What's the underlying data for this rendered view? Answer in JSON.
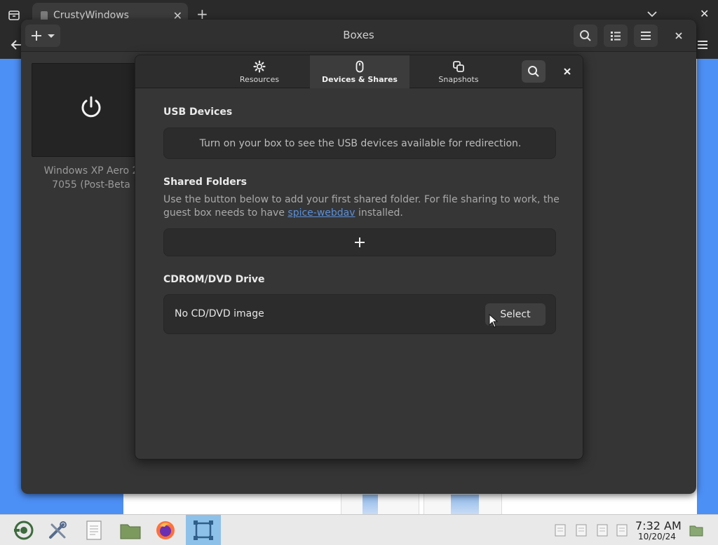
{
  "browser": {
    "tab_title": "CrustyWindows",
    "tab_close": "✕",
    "new_tab": "+",
    "window_close": "✕"
  },
  "boxes": {
    "title": "Boxes",
    "vm": {
      "name": "Windows XP Aero 2 7055 (Post-Beta"
    }
  },
  "dialog": {
    "tabs": [
      {
        "label": "Resources",
        "icon": "gear-icon"
      },
      {
        "label": "Devices & Shares",
        "icon": "mouse-icon"
      },
      {
        "label": "Snapshots",
        "icon": "snapshots-icon"
      }
    ],
    "active_tab": "Devices & Shares",
    "usb": {
      "title": "USB Devices",
      "message": "Turn on your box to see the USB devices available for redirection."
    },
    "shared": {
      "title": "Shared Folders",
      "desc_before": "Use the button below to add your first shared folder. For file sharing to work, the guest box needs to have ",
      "link": "spice-webdav",
      "desc_after": " installed."
    },
    "cdrom": {
      "title": "CDROM/DVD Drive",
      "label": "No CD/DVD image",
      "button": "Select"
    }
  },
  "taskbar": {
    "time": "7:32 AM",
    "date": "10/20/24"
  },
  "colors": {
    "accent_link": "#5b8fd8",
    "desktop_blue": "#4c8ff5",
    "active_task": "#8ec1ea"
  }
}
